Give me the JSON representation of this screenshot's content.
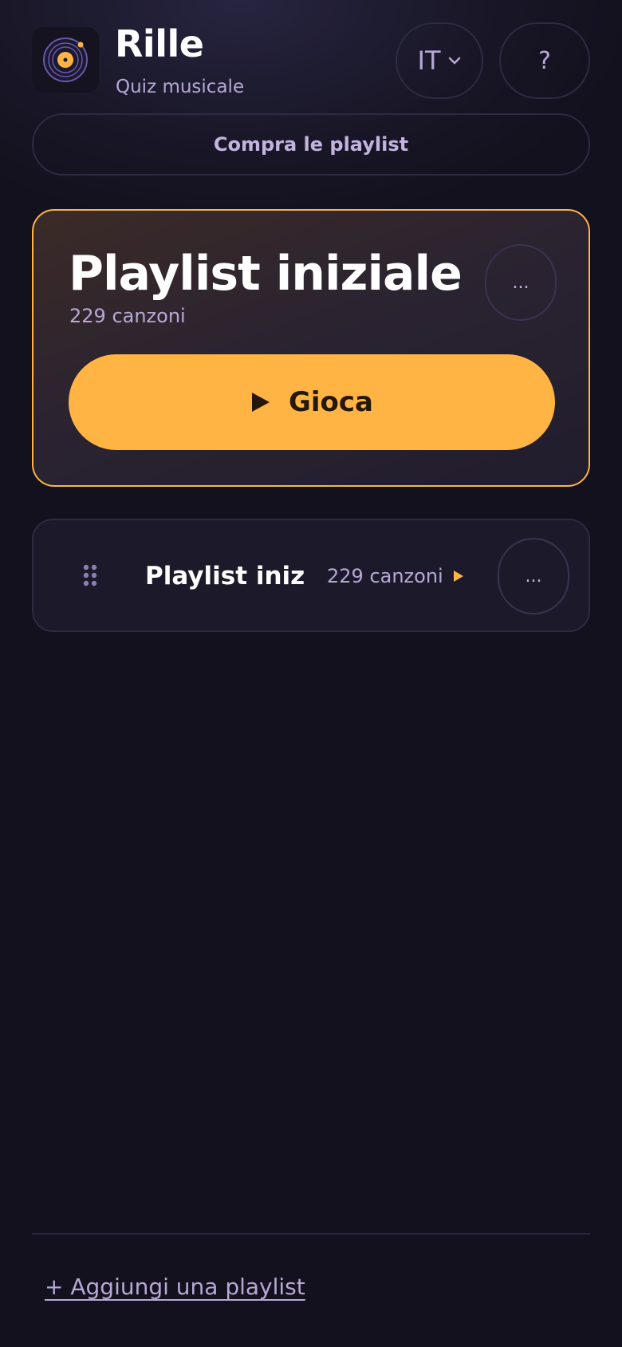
{
  "header": {
    "logo_icon": "vinyl-record-icon",
    "title": "Rille",
    "subtitle": "Quiz musicale",
    "language": "IT",
    "help_label": "?"
  },
  "buy_button": {
    "label": "Compra le playlist"
  },
  "featured": {
    "title": "Playlist iniziale",
    "count": "229 canzoni",
    "more_label": "...",
    "play_label": "Gioca"
  },
  "playlists": [
    {
      "title": "Playlist inizi...",
      "count": "229 canzoni",
      "more_label": "..."
    }
  ],
  "footer": {
    "add_label": "+ Aggiungi una playlist"
  },
  "colors": {
    "accent": "#ffb443",
    "background": "#13111d",
    "muted_text": "#b7a8d6"
  }
}
